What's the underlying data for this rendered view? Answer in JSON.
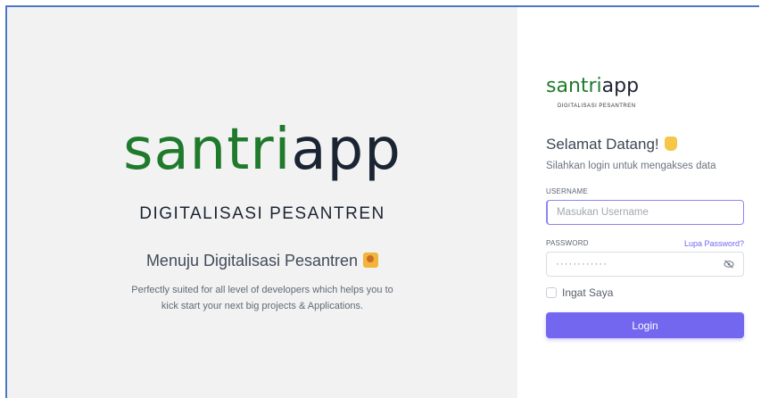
{
  "hero": {
    "logo_part1": "santri",
    "logo_part2": "app",
    "subtitle": "DIGITALISASI PESANTREN",
    "tagline": "Menuju Digitalisasi Pesantren",
    "description_line1": "Perfectly suited for all level of developers which helps you to",
    "description_line2": "kick start your next big projects & Applications."
  },
  "panel": {
    "logo_part1": "santri",
    "logo_part2": "app",
    "logo_sub": "DIGITALISASI PESANTREN",
    "welcome": "Selamat Datang!",
    "welcome_sub": "Silahkan login untuk mengakses data",
    "username_label": "USERNAME",
    "username_placeholder": "Masukan Username",
    "password_label": "PASSWORD",
    "forgot_label": "Lupa Password?",
    "password_value": "············",
    "remember_label": "Ingat Saya",
    "login_label": "Login"
  },
  "colors": {
    "brand_green": "#1f7a2c",
    "accent": "#7367f0",
    "frame": "#4a78c8"
  },
  "icons": {
    "tagline_emoji": "party-emoji-icon",
    "welcome_emoji": "waving-hand-icon",
    "password_toggle": "eye-off-icon"
  }
}
